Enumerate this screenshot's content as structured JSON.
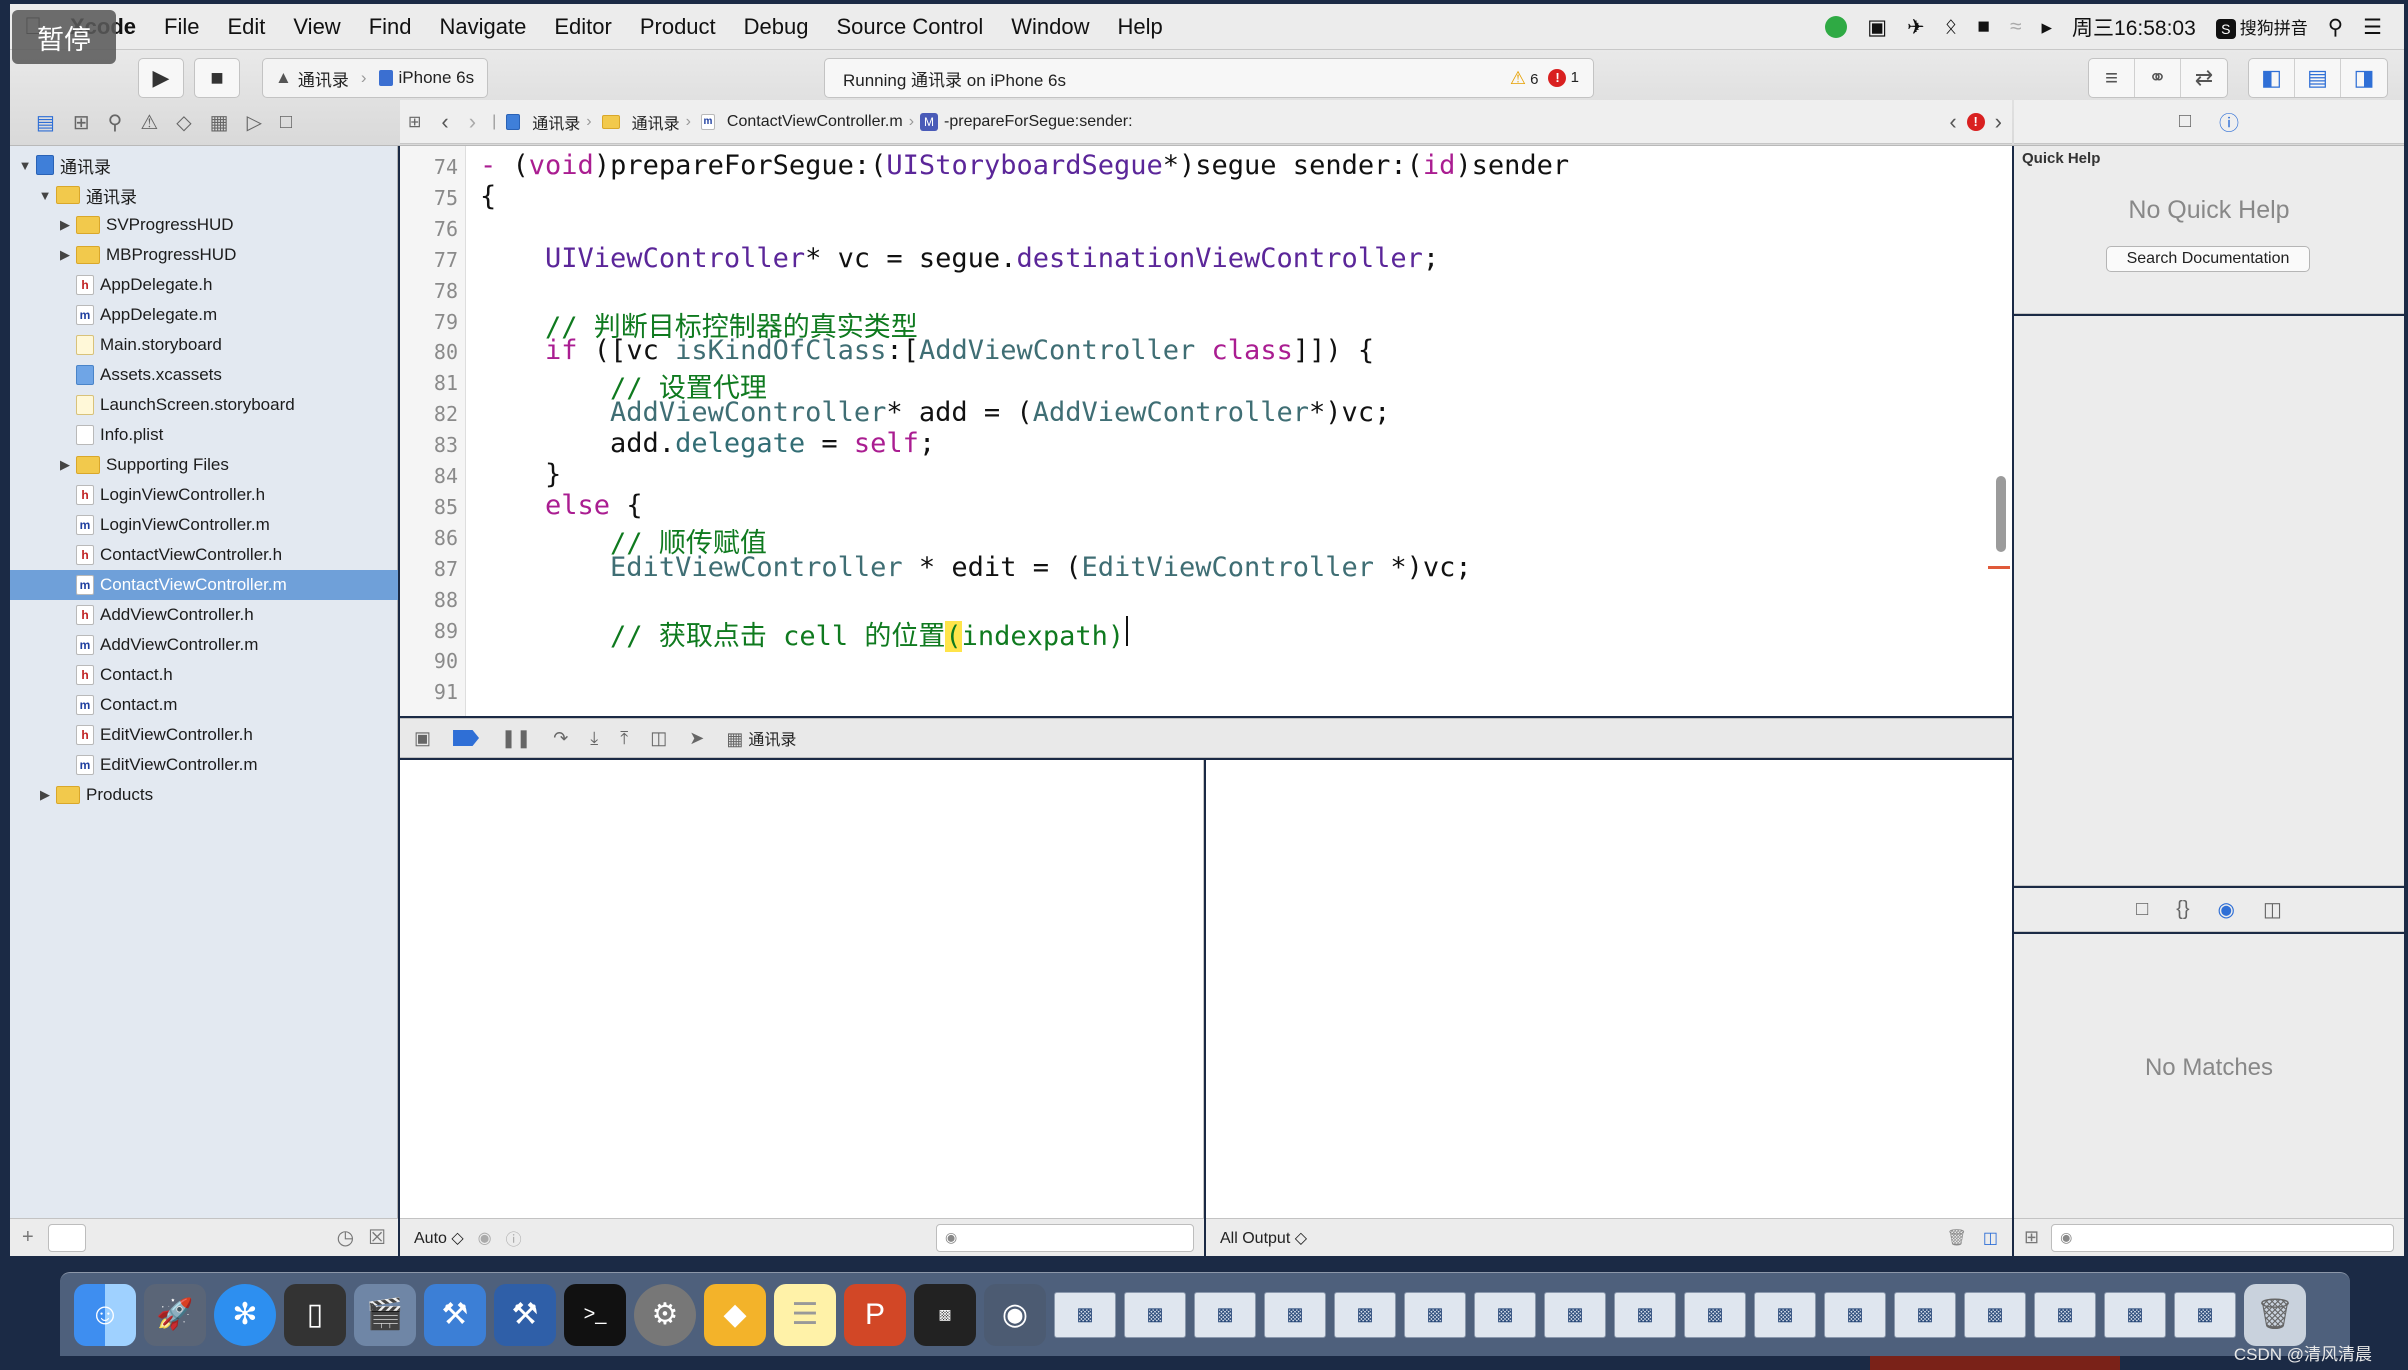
{
  "menubar": {
    "apple": "",
    "items": [
      "Xcode",
      "File",
      "Edit",
      "View",
      "Find",
      "Navigate",
      "Editor",
      "Product",
      "Debug",
      "Source Control",
      "Window",
      "Help"
    ],
    "clock": "周三16:58:03",
    "input_method": "搜狗拼音"
  },
  "toolbar": {
    "pause_overlay": "暂停",
    "scheme_project": "通讯录",
    "scheme_device": "iPhone 6s",
    "activity": "Running 通讯录 on iPhone 6s",
    "warnings": "6",
    "errors": "1"
  },
  "navigator": {
    "items": [
      {
        "label": "通讯录",
        "icon": "project-icon",
        "indent": 0,
        "disclosure": "open"
      },
      {
        "label": "通讯录",
        "icon": "folder-icon",
        "indent": 1,
        "disclosure": "open"
      },
      {
        "label": "SVProgressHUD",
        "icon": "folder-icon",
        "indent": 2,
        "disclosure": "closed"
      },
      {
        "label": "MBProgressHUD",
        "icon": "folder-icon",
        "indent": 2,
        "disclosure": "closed"
      },
      {
        "label": "AppDelegate.h",
        "icon": "header-file-icon",
        "indent": 2
      },
      {
        "label": "AppDelegate.m",
        "icon": "implementation-file-icon",
        "indent": 2
      },
      {
        "label": "Main.storyboard",
        "icon": "storyboard-icon",
        "indent": 2
      },
      {
        "label": "Assets.xcassets",
        "icon": "asset-catalog-icon",
        "indent": 2
      },
      {
        "label": "LaunchScreen.storyboard",
        "icon": "storyboard-icon",
        "indent": 2
      },
      {
        "label": "Info.plist",
        "icon": "plist-icon",
        "indent": 2
      },
      {
        "label": "Supporting Files",
        "icon": "folder-icon",
        "indent": 2,
        "disclosure": "closed"
      },
      {
        "label": "LoginViewController.h",
        "icon": "header-file-icon",
        "indent": 2
      },
      {
        "label": "LoginViewController.m",
        "icon": "implementation-file-icon",
        "indent": 2
      },
      {
        "label": "ContactViewController.h",
        "icon": "header-file-icon",
        "indent": 2
      },
      {
        "label": "ContactViewController.m",
        "icon": "implementation-file-icon",
        "indent": 2,
        "selected": true
      },
      {
        "label": "AddViewController.h",
        "icon": "header-file-icon",
        "indent": 2
      },
      {
        "label": "AddViewController.m",
        "icon": "implementation-file-icon",
        "indent": 2
      },
      {
        "label": "Contact.h",
        "icon": "header-file-icon",
        "indent": 2
      },
      {
        "label": "Contact.m",
        "icon": "implementation-file-icon",
        "indent": 2
      },
      {
        "label": "EditViewController.h",
        "icon": "header-file-icon",
        "indent": 2
      },
      {
        "label": "EditViewController.m",
        "icon": "implementation-file-icon",
        "indent": 2
      },
      {
        "label": "Products",
        "icon": "folder-icon",
        "indent": 1,
        "disclosure": "closed"
      }
    ]
  },
  "jumpbar": {
    "crumbs": [
      "通讯录",
      "通讯录",
      "ContactViewController.m",
      "-prepareForSegue:sender:"
    ]
  },
  "editor": {
    "lines": [
      {
        "n": "74",
        "html": "<span class=\"kw\">-</span> (<span class=\"kw\">void</span>)prepareForSegue:(<span class=\"ty2\">UIStoryboardSegue</span>*)segue sender:(<span class=\"kw\">id</span>)sender"
      },
      {
        "n": "75",
        "html": "{"
      },
      {
        "n": "76",
        "html": ""
      },
      {
        "n": "77",
        "html": "    <span class=\"ty2\">UIViewController</span>* vc = segue.<span class=\"ty2\">destinationViewController</span>;"
      },
      {
        "n": "78",
        "html": ""
      },
      {
        "n": "79",
        "html": "    <span class=\"cm\">// 判断目标控制器的真实类型</span>"
      },
      {
        "n": "80",
        "html": "    <span class=\"kw\">if</span> ([vc <span class=\"ty\">isKindOfClass</span>:[<span class=\"ty\">AddViewController</span> <span class=\"kw\">class</span>]]) {"
      },
      {
        "n": "81",
        "html": "        <span class=\"cm\">// 设置代理</span>"
      },
      {
        "n": "82",
        "html": "        <span class=\"ty\">AddViewController</span>* add = (<span class=\"ty\">AddViewController</span>*)vc;"
      },
      {
        "n": "83",
        "html": "        add.<span class=\"pr\">delegate</span> = <span class=\"kw\">self</span>;"
      },
      {
        "n": "84",
        "html": "    }"
      },
      {
        "n": "85",
        "html": "    <span class=\"kw\">else</span> {"
      },
      {
        "n": "86",
        "html": "        <span class=\"cm\">// 顺传赋值</span>"
      },
      {
        "n": "87",
        "html": "        <span class=\"ty\">EditViewController</span> * edit = (<span class=\"ty\">EditViewController</span> *)vc;"
      },
      {
        "n": "88",
        "html": ""
      },
      {
        "n": "89",
        "html": "        <span class=\"cm\">// 获取点击 cell 的位置<span class=\"hl\">(</span>indexpath)</span>"
      },
      {
        "n": "90",
        "html": ""
      },
      {
        "n": "91",
        "html": ""
      }
    ]
  },
  "debug": {
    "process": "通讯录",
    "variables_scope": "Auto ◇",
    "console_filter": "All Output ◇"
  },
  "utilities": {
    "quick_help_title": "Quick Help",
    "no_quick_help": "No Quick Help",
    "search_docs": "Search Documentation",
    "no_matches": "No Matches"
  },
  "watermark": "CSDN @清风清晨",
  "colors": {
    "keyword": "#aa1d91",
    "type": "#3f6e74",
    "class": "#5b2699",
    "comment": "#0f7a1f",
    "selection": "#6fa0d9",
    "arrow": "#e0412e"
  }
}
